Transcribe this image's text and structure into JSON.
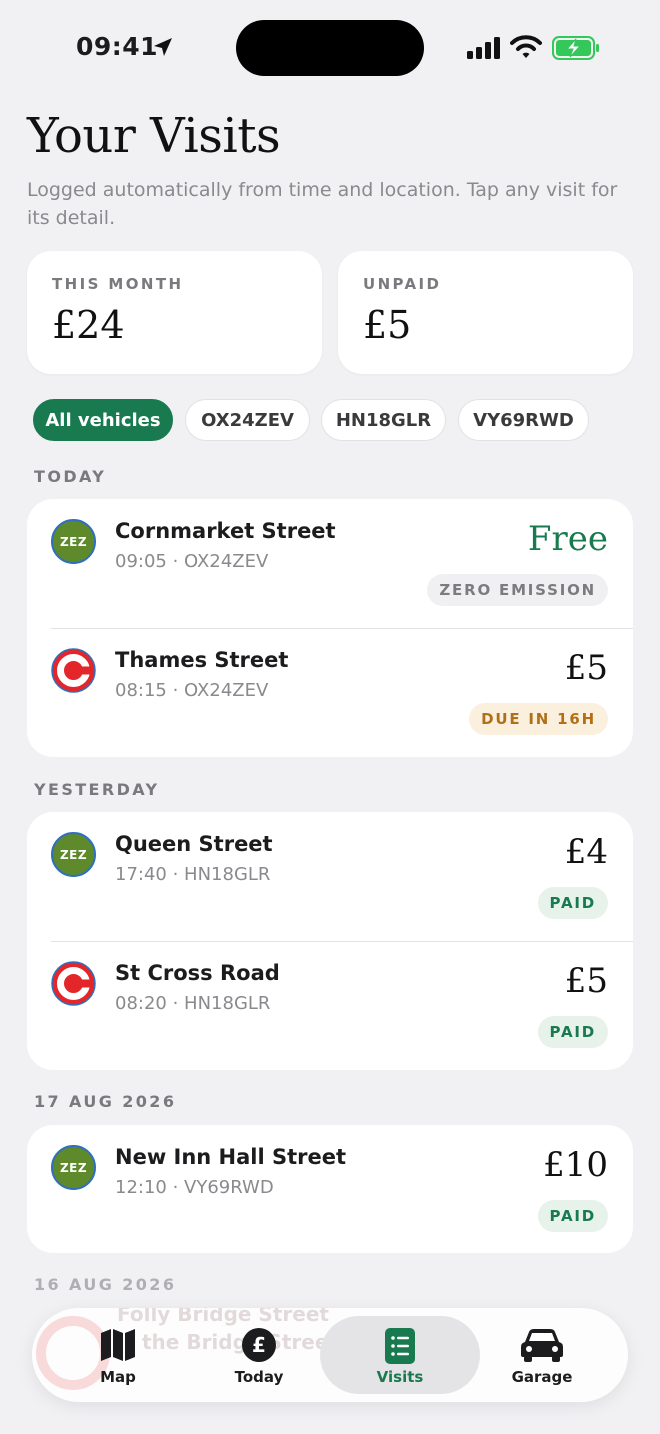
{
  "status_bar": {
    "time": "09:41"
  },
  "header": {
    "title": "Your Visits",
    "subtitle": "Logged automatically from time and location. Tap any visit for its detail."
  },
  "summary": {
    "this_month_label": "THIS MONTH",
    "this_month_value": "£24",
    "unpaid_label": "UNPAID",
    "unpaid_value": "£5"
  },
  "filters": [
    "All vehicles",
    "OX24ZEV",
    "HN18GLR",
    "VY69RWD"
  ],
  "sections": [
    {
      "label": "TODAY",
      "visits": [
        {
          "street": "Cornmarket Street",
          "meta": "09:05 · OX24ZEV",
          "amount": "Free",
          "badge": "ZERO EMISSION",
          "zone_icon": "zez-icon",
          "zone_text": "ZEZ"
        },
        {
          "street": "Thames Street",
          "meta": "08:15 · OX24ZEV",
          "amount": "£5",
          "badge": "DUE IN 16H",
          "zone_icon": "congestion-charge-icon"
        }
      ]
    },
    {
      "label": "YESTERDAY",
      "visits": [
        {
          "street": "Queen Street",
          "meta": "17:40 · HN18GLR",
          "amount": "£4",
          "badge": "PAID",
          "zone_icon": "zez-icon",
          "zone_text": "ZEZ"
        },
        {
          "street": "St Cross Road",
          "meta": "08:20 · HN18GLR",
          "amount": "£5",
          "badge": "PAID",
          "zone_icon": "congestion-charge-icon"
        }
      ]
    },
    {
      "label": "17 AUG 2026",
      "visits": [
        {
          "street": "New Inn Hall Street",
          "meta": "12:10 · VY69RWD",
          "amount": "£10",
          "badge": "PAID",
          "zone_icon": "zez-icon",
          "zone_text": "ZEZ"
        }
      ]
    },
    {
      "label": "16 AUG 2026"
    }
  ],
  "tabbar": {
    "items": [
      {
        "label": "Map",
        "icon": "map-icon"
      },
      {
        "label": "Today",
        "icon": "pound-icon"
      },
      {
        "label": "Visits",
        "icon": "list-icon"
      },
      {
        "label": "Garage",
        "icon": "car-icon"
      }
    ],
    "selected": "Visits",
    "ghost_text_1": "Folly Bridge Street",
    "ghost_text_2": "the Bridge Street"
  },
  "colors": {
    "accent": "#197a4f",
    "due": "#b0701a",
    "zez": "#5e8a2c",
    "congestion": "#e3262a",
    "background": "#f1f1f4"
  }
}
